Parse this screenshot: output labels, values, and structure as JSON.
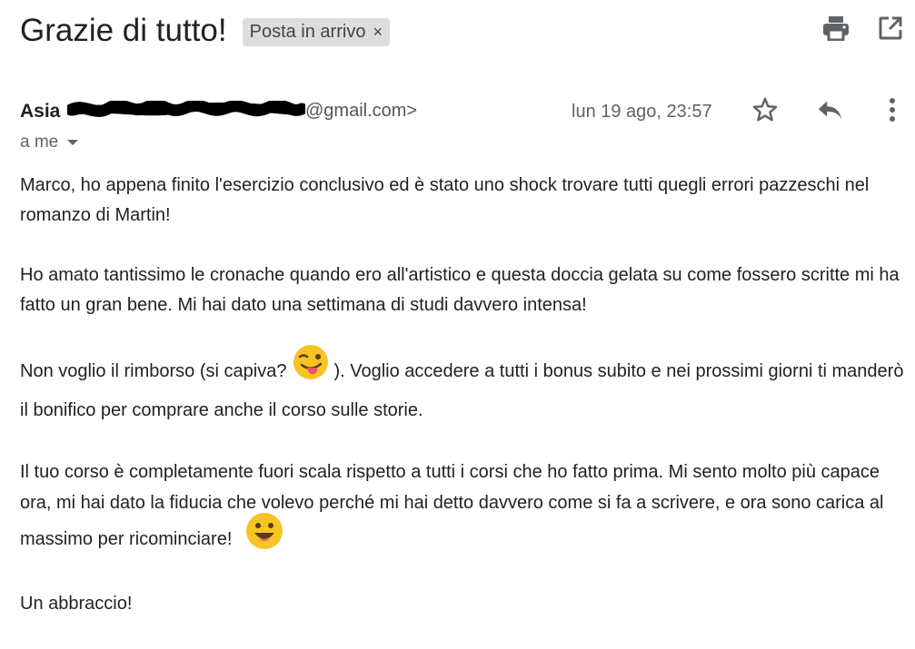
{
  "subject": "Grazie di tutto!",
  "label": {
    "text": "Posta in arrivo",
    "remove_glyph": "×"
  },
  "toolbar": {
    "print_icon": "print-icon",
    "popout_icon": "open-in-new-window-icon"
  },
  "sender": {
    "name": "Asia",
    "email_visible_suffix": "@gmail.com>",
    "date": "lun 19 ago, 23:57"
  },
  "recipient": {
    "text": "a me"
  },
  "message": {
    "p1": "Marco, ho appena finito l'esercizio conclusivo ed è stato uno shock trovare tutti quegli errori pazzeschi nel romanzo di Martin!",
    "p2": "Ho amato tantissimo le cronache quando ero all'artistico e questa doccia gelata su come fossero scritte mi ha fatto un gran bene. Mi hai dato una settimana di studi davvero intensa!",
    "p3_before": "Non voglio il rimborso (si capiva?",
    "p3_after": "). Voglio accedere a tutti i bonus subito e nei prossimi giorni ti manderò il bonifico per comprare anche il corso sulle storie.",
    "p4": "Il tuo corso è completamente fuori scala rispetto a tutti i corsi che ho fatto prima. Mi sento molto più capace ora, mi hai dato la fiducia che volevo perché mi hai detto davvero come si fa a scrivere, e ora sono carica al massimo per ricominciare!",
    "p5": "Un abbraccio!"
  },
  "colors": {
    "chip_bg": "#dddddd",
    "icon_gray": "#5f6368",
    "emoji_yellow": "#f7c325"
  }
}
